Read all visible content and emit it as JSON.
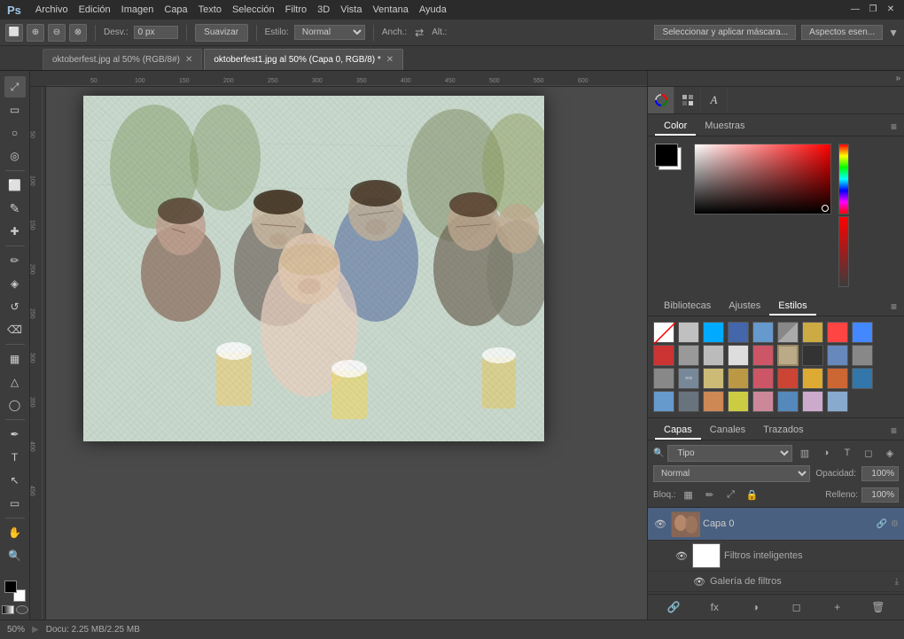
{
  "app": {
    "logo": "Ps",
    "menu": [
      "Archivo",
      "Edición",
      "Imagen",
      "Capa",
      "Texto",
      "Selección",
      "Filtro",
      "3D",
      "Vista",
      "Ventana",
      "Ayuda"
    ],
    "winbtns": [
      "—",
      "❐",
      "✕"
    ]
  },
  "optionsbar": {
    "style_label": "Estilo:",
    "style_value": "Normal",
    "desv_label": "Desv.:",
    "desv_value": "0 px",
    "suavizar": "Suavizar",
    "anch_label": "Anch.:",
    "alt_label": "Alt.:",
    "select_btn": "Seleccionar y aplicar máscara...",
    "aspects_btn": "Aspectos esen..."
  },
  "tabs": [
    {
      "label": "oktoberfest.jpg al 50% (RGB/8#)",
      "active": false
    },
    {
      "label": "oktoberfest1.jpg al 50% (Capa 0, RGB/8) *",
      "active": true
    }
  ],
  "color_panel": {
    "tabs": [
      "Color",
      "Muestras"
    ],
    "active_tab": "Color"
  },
  "style_panel": {
    "tabs": [
      "Bibliotecas",
      "Ajustes",
      "Estilos"
    ],
    "active_tab": "Estilos",
    "swatches": [
      {
        "bg": "transparent",
        "cross": true
      },
      {
        "bg": "#c8c8c8"
      },
      {
        "bg": "#00aaff"
      },
      {
        "bg": "#4466aa"
      },
      {
        "bg": "#6699cc"
      },
      {
        "bg": "#888888",
        "split": true
      },
      {
        "bg": "#ccaa44"
      },
      {
        "bg": "#ff4444"
      },
      {
        "bg": "#4488ff"
      },
      {
        "bg": "#ff4444"
      },
      {
        "bg": "#aaaaaa"
      },
      {
        "bg": "#cccccc"
      },
      {
        "bg": "#dddddd"
      },
      {
        "bg": "#cc5566"
      },
      {
        "bg": "#bbaa88"
      },
      {
        "bg": "#444444"
      },
      {
        "bg": "#6688bb"
      },
      {
        "bg": "#aaaaaa"
      },
      {
        "bg": "#ccbb77"
      },
      {
        "bg": "#444455"
      },
      {
        "bg": "#dd9933"
      },
      {
        "bg": "#ff8833"
      },
      {
        "bg": "#998855"
      },
      {
        "bg": "#aabb99"
      },
      {
        "bg": "#ddaa55"
      },
      {
        "bg": "#cc8833"
      },
      {
        "bg": "#5588aa"
      },
      {
        "bg": "#aaaadd"
      },
      {
        "bg": "#88aacc"
      },
      {
        "bg": "#ee8855"
      },
      {
        "bg": "#cccc44"
      },
      {
        "bg": "#dd99aa"
      },
      {
        "bg": "#5588bb"
      },
      {
        "bg": "#ccaacc"
      },
      {
        "bg": "#88aacc"
      }
    ]
  },
  "layers_panel": {
    "tabs": [
      "Capas",
      "Canales",
      "Trazados"
    ],
    "active_tab": "Capas",
    "search_placeholder": "Tipo",
    "blend_mode": "Normal",
    "opacity_label": "Opacidad:",
    "opacity_value": "100%",
    "bloque_label": "Bloq.:",
    "relleno_label": "Relleno:",
    "relleno_value": "100%",
    "layers": [
      {
        "name": "Capa 0",
        "visible": true,
        "active": true,
        "has_link": true,
        "thumb_bg": "#886655"
      },
      {
        "name": "Filtros inteligentes",
        "visible": true,
        "active": false,
        "indent": true,
        "thumb_bg": "#ffffff"
      },
      {
        "name": "Galería de filtros",
        "visible": true,
        "active": false,
        "indent": true,
        "thumb_bg": ""
      }
    ],
    "footer_btns": [
      "fx",
      "◑",
      "✕"
    ]
  },
  "statusbar": {
    "zoom": "50%",
    "info": "Docu: 2.25 MB/2.25 MB"
  },
  "tools": [
    "⤢",
    "▭",
    "○",
    "✏",
    "🖊",
    "✂",
    "⊕",
    "🖊",
    "⌫",
    "🔠",
    "✋",
    "🔍"
  ]
}
